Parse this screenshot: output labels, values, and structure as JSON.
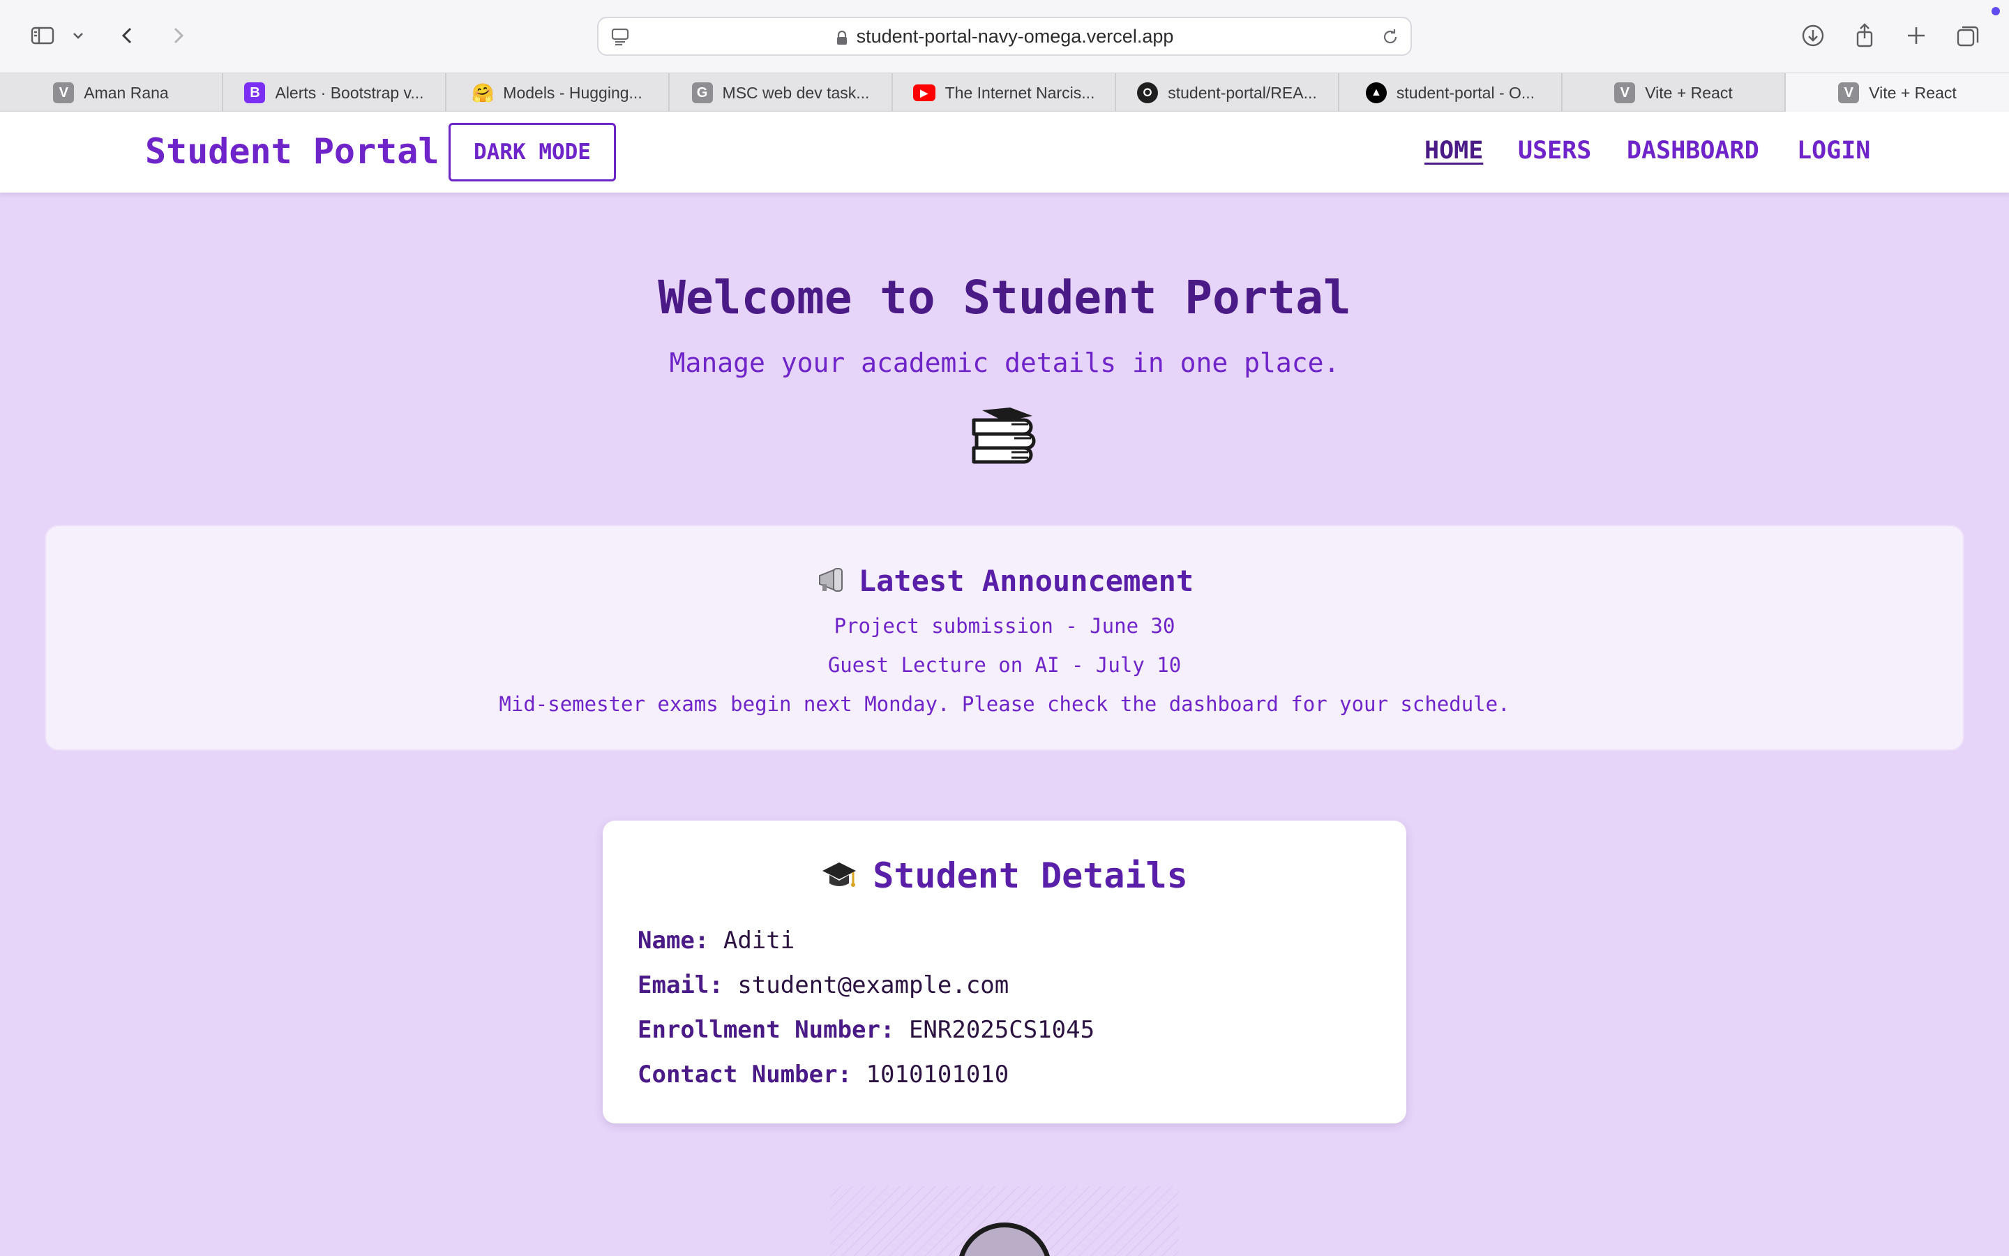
{
  "browser": {
    "url": "student-portal-navy-omega.vercel.app",
    "tabs": [
      {
        "label": "Aman Rana",
        "favicon": "V",
        "fav_color": "#8e8e93"
      },
      {
        "label": "Alerts · Bootstrap v...",
        "favicon": "B",
        "fav_color": "#7b2ff2"
      },
      {
        "label": "Models - Hugging...",
        "favicon": "🤗",
        "fav_color": "transparent"
      },
      {
        "label": "MSC web dev task...",
        "favicon": "G",
        "fav_color": "#8e8e93"
      },
      {
        "label": "The Internet Narcis...",
        "favicon": "▶",
        "fav_color": "#ff0000"
      },
      {
        "label": "student-portal/REA...",
        "favicon": "github",
        "fav_color": "#1f1f1f"
      },
      {
        "label": "student-portal - O...",
        "favicon": "▲",
        "fav_color": "#000000"
      },
      {
        "label": "Vite + React",
        "favicon": "V",
        "fav_color": "#8e8e93"
      },
      {
        "label": "Vite + React",
        "favicon": "V",
        "fav_color": "#8e8e93"
      }
    ]
  },
  "header": {
    "brand": "Student Portal",
    "dark_mode_label": "DARK MODE",
    "nav": [
      {
        "label": "HOME",
        "active": true
      },
      {
        "label": "USERS",
        "active": false
      },
      {
        "label": "DASHBOARD",
        "active": false
      },
      {
        "label": "LOGIN",
        "active": false
      }
    ]
  },
  "hero": {
    "title": "Welcome to Student Portal",
    "subtitle": "Manage your academic details in one place.",
    "icon": "books-icon"
  },
  "announcement": {
    "title": "Latest Announcement",
    "icon": "megaphone-icon",
    "items": [
      "Project submission - June 30",
      "Guest Lecture on AI - July 10",
      "Mid-semester exams begin next Monday. Please check the dashboard for your schedule."
    ]
  },
  "student": {
    "title": "Student Details",
    "icon": "graduation-cap-icon",
    "fields": [
      {
        "label": "Name:",
        "value": "Aditi"
      },
      {
        "label": "Email:",
        "value": "student@example.com"
      },
      {
        "label": "Enrollment Number:",
        "value": "ENR2025CS1045"
      },
      {
        "label": "Contact Number:",
        "value": "1010101010"
      }
    ]
  },
  "colors": {
    "page_bg": "#e6d5f8",
    "accent": "#6f24c9",
    "heading": "#4a1a86"
  }
}
